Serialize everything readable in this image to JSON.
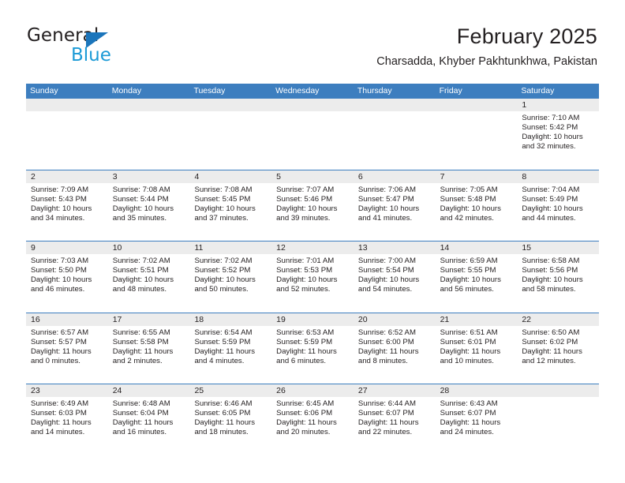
{
  "brand": {
    "name_top": "General",
    "name_bottom": "Blue",
    "accent_color": "#1b75bb",
    "accent_color_light": "#1b9ad6"
  },
  "header": {
    "title": "February 2025",
    "subtitle": "Charsadda, Khyber Pakhtunkhwa, Pakistan"
  },
  "calendar": {
    "header_bg": "#3d7ebf",
    "daynum_band_bg": "#ececec",
    "weekdays": [
      "Sunday",
      "Monday",
      "Tuesday",
      "Wednesday",
      "Thursday",
      "Friday",
      "Saturday"
    ],
    "weeks": [
      [
        {
          "day": "",
          "empty": true
        },
        {
          "day": "",
          "empty": true
        },
        {
          "day": "",
          "empty": true
        },
        {
          "day": "",
          "empty": true
        },
        {
          "day": "",
          "empty": true
        },
        {
          "day": "",
          "empty": true
        },
        {
          "day": "1",
          "sunrise": "Sunrise: 7:10 AM",
          "sunset": "Sunset: 5:42 PM",
          "daylight": "Daylight: 10 hours and 32 minutes."
        }
      ],
      [
        {
          "day": "2",
          "sunrise": "Sunrise: 7:09 AM",
          "sunset": "Sunset: 5:43 PM",
          "daylight": "Daylight: 10 hours and 34 minutes."
        },
        {
          "day": "3",
          "sunrise": "Sunrise: 7:08 AM",
          "sunset": "Sunset: 5:44 PM",
          "daylight": "Daylight: 10 hours and 35 minutes."
        },
        {
          "day": "4",
          "sunrise": "Sunrise: 7:08 AM",
          "sunset": "Sunset: 5:45 PM",
          "daylight": "Daylight: 10 hours and 37 minutes."
        },
        {
          "day": "5",
          "sunrise": "Sunrise: 7:07 AM",
          "sunset": "Sunset: 5:46 PM",
          "daylight": "Daylight: 10 hours and 39 minutes."
        },
        {
          "day": "6",
          "sunrise": "Sunrise: 7:06 AM",
          "sunset": "Sunset: 5:47 PM",
          "daylight": "Daylight: 10 hours and 41 minutes."
        },
        {
          "day": "7",
          "sunrise": "Sunrise: 7:05 AM",
          "sunset": "Sunset: 5:48 PM",
          "daylight": "Daylight: 10 hours and 42 minutes."
        },
        {
          "day": "8",
          "sunrise": "Sunrise: 7:04 AM",
          "sunset": "Sunset: 5:49 PM",
          "daylight": "Daylight: 10 hours and 44 minutes."
        }
      ],
      [
        {
          "day": "9",
          "sunrise": "Sunrise: 7:03 AM",
          "sunset": "Sunset: 5:50 PM",
          "daylight": "Daylight: 10 hours and 46 minutes."
        },
        {
          "day": "10",
          "sunrise": "Sunrise: 7:02 AM",
          "sunset": "Sunset: 5:51 PM",
          "daylight": "Daylight: 10 hours and 48 minutes."
        },
        {
          "day": "11",
          "sunrise": "Sunrise: 7:02 AM",
          "sunset": "Sunset: 5:52 PM",
          "daylight": "Daylight: 10 hours and 50 minutes."
        },
        {
          "day": "12",
          "sunrise": "Sunrise: 7:01 AM",
          "sunset": "Sunset: 5:53 PM",
          "daylight": "Daylight: 10 hours and 52 minutes."
        },
        {
          "day": "13",
          "sunrise": "Sunrise: 7:00 AM",
          "sunset": "Sunset: 5:54 PM",
          "daylight": "Daylight: 10 hours and 54 minutes."
        },
        {
          "day": "14",
          "sunrise": "Sunrise: 6:59 AM",
          "sunset": "Sunset: 5:55 PM",
          "daylight": "Daylight: 10 hours and 56 minutes."
        },
        {
          "day": "15",
          "sunrise": "Sunrise: 6:58 AM",
          "sunset": "Sunset: 5:56 PM",
          "daylight": "Daylight: 10 hours and 58 minutes."
        }
      ],
      [
        {
          "day": "16",
          "sunrise": "Sunrise: 6:57 AM",
          "sunset": "Sunset: 5:57 PM",
          "daylight": "Daylight: 11 hours and 0 minutes."
        },
        {
          "day": "17",
          "sunrise": "Sunrise: 6:55 AM",
          "sunset": "Sunset: 5:58 PM",
          "daylight": "Daylight: 11 hours and 2 minutes."
        },
        {
          "day": "18",
          "sunrise": "Sunrise: 6:54 AM",
          "sunset": "Sunset: 5:59 PM",
          "daylight": "Daylight: 11 hours and 4 minutes."
        },
        {
          "day": "19",
          "sunrise": "Sunrise: 6:53 AM",
          "sunset": "Sunset: 5:59 PM",
          "daylight": "Daylight: 11 hours and 6 minutes."
        },
        {
          "day": "20",
          "sunrise": "Sunrise: 6:52 AM",
          "sunset": "Sunset: 6:00 PM",
          "daylight": "Daylight: 11 hours and 8 minutes."
        },
        {
          "day": "21",
          "sunrise": "Sunrise: 6:51 AM",
          "sunset": "Sunset: 6:01 PM",
          "daylight": "Daylight: 11 hours and 10 minutes."
        },
        {
          "day": "22",
          "sunrise": "Sunrise: 6:50 AM",
          "sunset": "Sunset: 6:02 PM",
          "daylight": "Daylight: 11 hours and 12 minutes."
        }
      ],
      [
        {
          "day": "23",
          "sunrise": "Sunrise: 6:49 AM",
          "sunset": "Sunset: 6:03 PM",
          "daylight": "Daylight: 11 hours and 14 minutes."
        },
        {
          "day": "24",
          "sunrise": "Sunrise: 6:48 AM",
          "sunset": "Sunset: 6:04 PM",
          "daylight": "Daylight: 11 hours and 16 minutes."
        },
        {
          "day": "25",
          "sunrise": "Sunrise: 6:46 AM",
          "sunset": "Sunset: 6:05 PM",
          "daylight": "Daylight: 11 hours and 18 minutes."
        },
        {
          "day": "26",
          "sunrise": "Sunrise: 6:45 AM",
          "sunset": "Sunset: 6:06 PM",
          "daylight": "Daylight: 11 hours and 20 minutes."
        },
        {
          "day": "27",
          "sunrise": "Sunrise: 6:44 AM",
          "sunset": "Sunset: 6:07 PM",
          "daylight": "Daylight: 11 hours and 22 minutes."
        },
        {
          "day": "28",
          "sunrise": "Sunrise: 6:43 AM",
          "sunset": "Sunset: 6:07 PM",
          "daylight": "Daylight: 11 hours and 24 minutes."
        },
        {
          "day": "",
          "empty": true
        }
      ]
    ]
  }
}
